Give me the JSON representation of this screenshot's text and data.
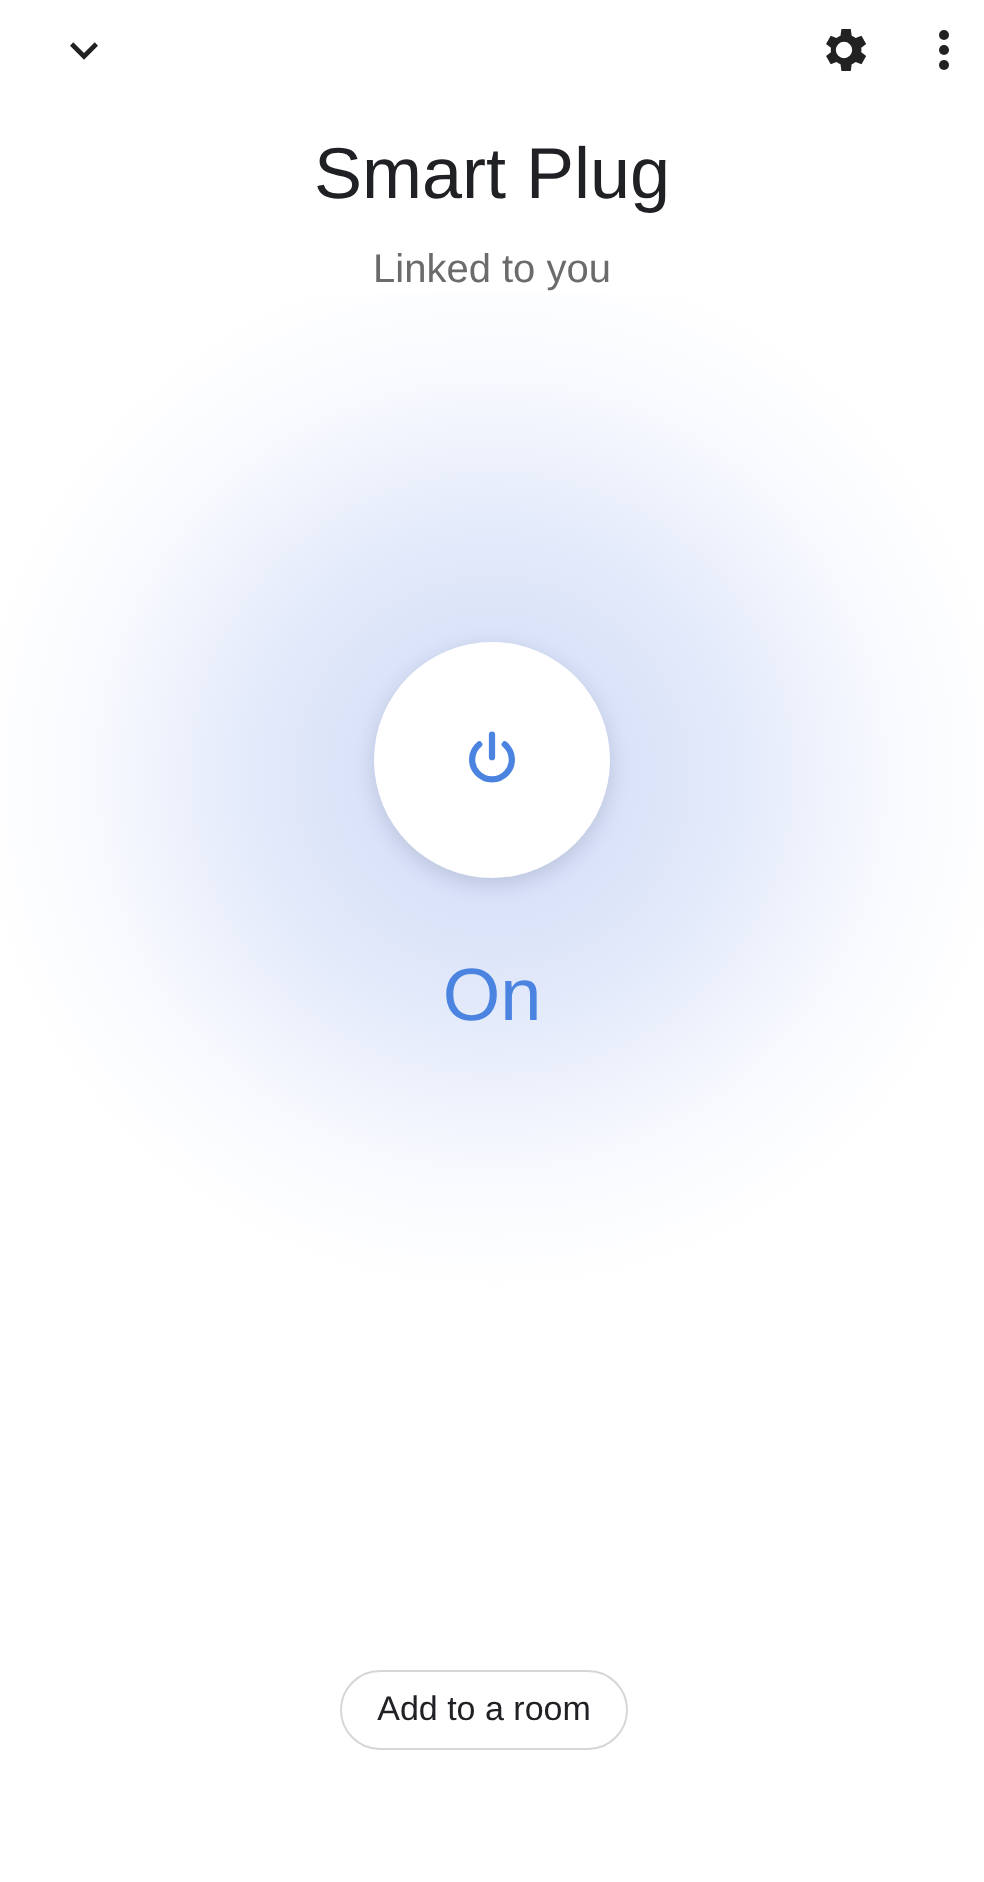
{
  "header": {
    "title": "Smart Plug",
    "subtitle": "Linked to you"
  },
  "power": {
    "on": true,
    "state_label": "On"
  },
  "room_button": {
    "label": "Add to a room"
  }
}
